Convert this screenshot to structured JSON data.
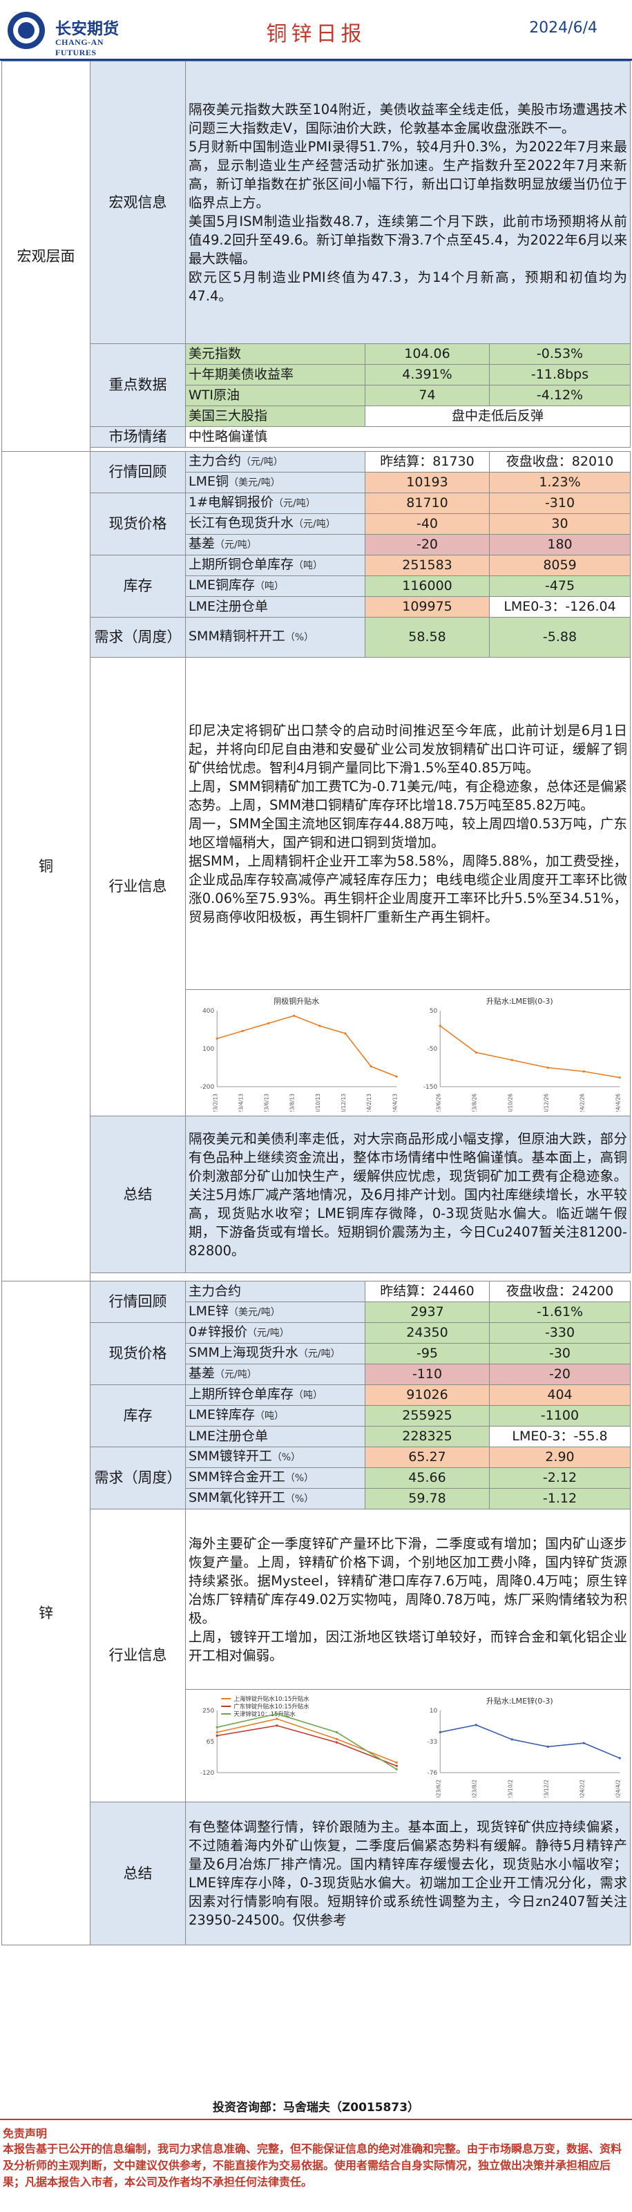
{
  "header": {
    "logo_cn": "长安期货",
    "logo_en": "CHANG-AN FUTURES",
    "title": "铜锌日报",
    "date": "2024/6/4"
  },
  "macro": {
    "section": "宏观层面",
    "info_label": "宏观信息",
    "info_text": "隔夜美元指数大跌至104附近，美债收益率全线走低，美股市场遭遇技术问题三大指数走V，国际油价大跌，伦敦基本金属收盘涨跌不一。\n5月财新中国制造业PMI录得51.7%，较4月升0.3%，为2022年7月来最高，显示制造业生产经营活动扩张加速。生产指数升至2022年7月来新高，新订单指数在扩张区间小幅下行，新出口订单指数明显放缓当仍位于临界点上方。\n美国5月ISM制造业指数48.7，连续第二个月下跌，此前市场预期将从前值49.2回升至49.6。新订单指数下滑3.7个点至45.4，为2022年6月以来最大跌幅。\n欧元区5月制造业PMI终值为47.3，为14个月新高，预期和初值均为47.4。",
    "key_label": "重点数据",
    "key_rows": [
      {
        "name": "美元指数",
        "v1": "104.06",
        "v2": "-0.53%"
      },
      {
        "name": "十年期美债收益率",
        "v1": "4.391%",
        "v2": "-11.8bps"
      },
      {
        "name": "WTI原油",
        "v1": "74",
        "v2": "-4.12%"
      },
      {
        "name": "美国三大股指",
        "v1": "盘中走低后反弹"
      }
    ],
    "sentiment_label": "市场情绪",
    "sentiment": "中性略偏谨慎"
  },
  "copper": {
    "section": "铜",
    "quote_label": "行情回顾",
    "main_contract": "主力合约",
    "unit_yuan_t": "（元/吨）",
    "main_yesterday": "昨结算：81730",
    "main_night": "夜盘收盘：82010",
    "lme_label": "LME铜",
    "unit_usd_t": "（美元/吨）",
    "lme_price": "10193",
    "lme_change": "1.23%",
    "spot_label": "现货价格",
    "spot_rows": [
      {
        "name": "1#电解铜报价",
        "unit": "（元/吨）",
        "v1": "81710",
        "v2": "-310"
      },
      {
        "name": "长江有色现货升水",
        "unit": "（元/吨）",
        "v1": "-40",
        "v2": "30"
      },
      {
        "name": "基差",
        "unit": "（元/吨）",
        "v1": "-20",
        "v2": "180"
      }
    ],
    "stock_label": "库存",
    "stock_rows": [
      {
        "name": "上期所铜仓单库存",
        "unit": "（吨）",
        "v1": "251583",
        "v2": "8059"
      },
      {
        "name": "LME铜库存",
        "unit": "（吨）",
        "v1": "116000",
        "v2": "-475"
      },
      {
        "name": "LME注册仓单",
        "v1": "109975",
        "v2": "LME0-3：-126.04"
      }
    ],
    "demand_label": "需求（周度）",
    "demand_rows": [
      {
        "name": "SMM精铜杆开工",
        "unit": "（%）",
        "v1": "58.58",
        "v2": "-5.88"
      }
    ],
    "industry_label": "行业信息",
    "industry_text": "印尼决定将铜矿出口禁令的启动时间推迟至今年底，此前计划是6月1日起，并将向印尼自由港和安曼矿业公司发放铜精矿出口许可证，缓解了铜矿供给忧虑。智利4月铜产量同比下滑1.5%至40.85万吨。\n上周，SMM铜精矿加工费TC为-0.71美元/吨，有企稳迹象，总体还是偏紧态势。上周，SMM港口铜精矿库存环比增18.75万吨至85.82万吨。\n周一，SMM全国主流地区铜库存44.88万吨，较上周四增0.53万吨，广东地区增幅稍大，国产铜和进口铜到货增加。\n据SMM，上周精铜杆企业开工率为58.58%，周降5.88%，加工费受挫，企业成品库存较高减停产减轻库存压力；电线电缆企业周度开工率环比微涨0.06%至75.93%。再生铜杆企业周度开工率环比升5.5%至34.51%，贸易商停收阳极板，再生铜杆厂重新生产再生铜杆。",
    "chart1_title": "阴极铜升贴水",
    "chart2_title": "升贴水:LME铜(0-3)",
    "summary_label": "总结",
    "summary_text": "隔夜美元和美债利率走低，对大宗商品形成小幅支撑，但原油大跌，部分有色品种上继续资金流出，整体市场情绪中性略偏谨慎。基本面上，高铜价刺激部分矿山加快生产，缓解供应忧虑，现货铜矿加工费有企稳迹象。关注5月炼厂减产落地情况，及6月排产计划。国内社库继续增长，水平较高，现货贴水收窄；LME铜库存微降，0-3现货贴水偏大。临近端午假期，下游备货或有增长。短期铜价震荡为主，今日Cu2407暂关注81200-82800。"
  },
  "zinc": {
    "section": "锌",
    "quote_label": "行情回顾",
    "main_contract": "主力合约",
    "main_yesterday": "昨结算：24460",
    "main_night": "夜盘收盘：24200",
    "lme_label": "LME锌",
    "unit_usd_t": "（美元/吨）",
    "lme_price": "2937",
    "lme_change": "-1.61%",
    "spot_label": "现货价格",
    "spot_rows": [
      {
        "name": "0#锌报价",
        "unit": "（元/吨）",
        "v1": "24350",
        "v2": "-330"
      },
      {
        "name": "SMM上海现货升水",
        "unit": "（元/吨）",
        "v1": "-95",
        "v2": "-30"
      },
      {
        "name": "基差",
        "unit": "（元/吨）",
        "v1": "-110",
        "v2": "-20"
      }
    ],
    "stock_label": "库存",
    "stock_rows": [
      {
        "name": "上期所锌仓单库存",
        "unit": "（吨）",
        "v1": "91026",
        "v2": "404"
      },
      {
        "name": "LME锌库存",
        "unit": "（吨）",
        "v1": "255925",
        "v2": "-1100"
      },
      {
        "name": "LME注册仓单",
        "v1": "228325",
        "v2": "LME0-3：-55.8"
      }
    ],
    "demand_label": "需求（周度）",
    "demand_rows": [
      {
        "name": "SMM镀锌开工",
        "unit": "（%）",
        "v1": "65.27",
        "v2": "2.90"
      },
      {
        "name": "SMM锌合金开工",
        "unit": "（%）",
        "v1": "45.66",
        "v2": "-2.12"
      },
      {
        "name": "SMM氧化锌开工",
        "unit": "（%）",
        "v1": "59.78",
        "v2": "-1.12"
      }
    ],
    "industry_label": "行业信息",
    "industry_text": "海外主要矿企一季度锌矿产量环比下滑，二季度或有增加；国内矿山逐步恢复产量。上周，锌精矿价格下调，个别地区加工费小降，国内锌矿货源持续紧张。据Mysteel，锌精矿港口库存7.6万吨，周降0.4万吨；原生锌冶炼厂锌精矿库存49.02万实物吨，周降0.78万吨，炼厂采购情绪较为积极。\n上周，镀锌开工增加，因江浙地区铁塔订单较好，而锌合金和氧化铝企业开工相对偏弱。",
    "chart1_legend": [
      "上海锌锭升贴水10:15升贴水",
      "广东锌锭升贴水10:15升贴水",
      "天津锌锭10：15升贴水"
    ],
    "chart2_title": "升贴水:LME锌(0-3)",
    "summary_label": "总结",
    "summary_text": "有色整体调整行情，锌价跟随为主。基本面上，现货锌矿供应持续偏紧，不过随着海内外矿山恢复，二季度后偏紧态势料有缓解。静待5月精锌产量及6月冶炼厂排产情况。国内精锌库存缓慢去化，现货贴水小幅收窄；LME锌库存小降，0-3现货贴水偏大。初端加工企业开工情况分化，需求因素对行情影响有限。短期锌价或系统性调整为主，今日zn2407暂关注23950-24500。仅供参考"
  },
  "footer": {
    "analyst": "投资咨询部：马舍瑞夫（Z0015873）",
    "disclaimer_title": "免责声明",
    "disclaimer": "本报告基于已公开的信息编制，我司力求信息准确、完整，但不能保证信息的绝对准确和完整。由于市场瞬息万变，数据、资料及分析师的主观判断，文中建议仅供参考，不能直接作为交易依据。使用者需结合自身实际情况，独立做出决策并承担相应后果；凡据本报告入市者，本公司及作者均不承担任何法律责任。"
  },
  "chart_data": [
    {
      "type": "line",
      "title": "阴极铜升贴水",
      "x": [
        "2023/2/13",
        "2023/4/13",
        "2023/6/13",
        "2023/8/13",
        "2023/10/13",
        "2023/12/13",
        "2024/2/13",
        "2024/4/13"
      ],
      "series": [
        {
          "values": [
            180,
            240,
            300,
            360,
            280,
            220,
            -40,
            -120
          ]
        }
      ],
      "ylim": [
        -200,
        400
      ]
    },
    {
      "type": "line",
      "title": "升贴水:LME铜(0-3)",
      "x": [
        "2023/6/26",
        "2023/8/26",
        "2023/10/26",
        "2023/12/26",
        "2024/2/26",
        "2024/4/26"
      ],
      "series": [
        {
          "values": [
            10,
            -60,
            -80,
            -100,
            -110,
            -126
          ]
        }
      ],
      "ylim": [
        -150,
        50
      ]
    },
    {
      "type": "line",
      "legend": [
        "上海锌锭升贴水10:15升贴水",
        "广东锌锭升贴水10:15升贴水",
        "天津锌锭10：15升贴水"
      ],
      "series": [
        {
          "values": [
            120,
            200,
            80,
            -60
          ]
        },
        {
          "values": [
            100,
            160,
            60,
            -80
          ]
        },
        {
          "values": [
            150,
            230,
            120,
            -100
          ]
        }
      ]
    },
    {
      "type": "line",
      "title": "升贴水:LME锌(0-3)",
      "x": [
        "2023/6/2",
        "2023/8/2",
        "2023/10/2",
        "2023/12/2",
        "2024/2/2",
        "2024/4/2"
      ],
      "series": [
        {
          "values": [
            -20,
            -10,
            -30,
            -40,
            -35,
            -55.8
          ]
        }
      ]
    }
  ]
}
